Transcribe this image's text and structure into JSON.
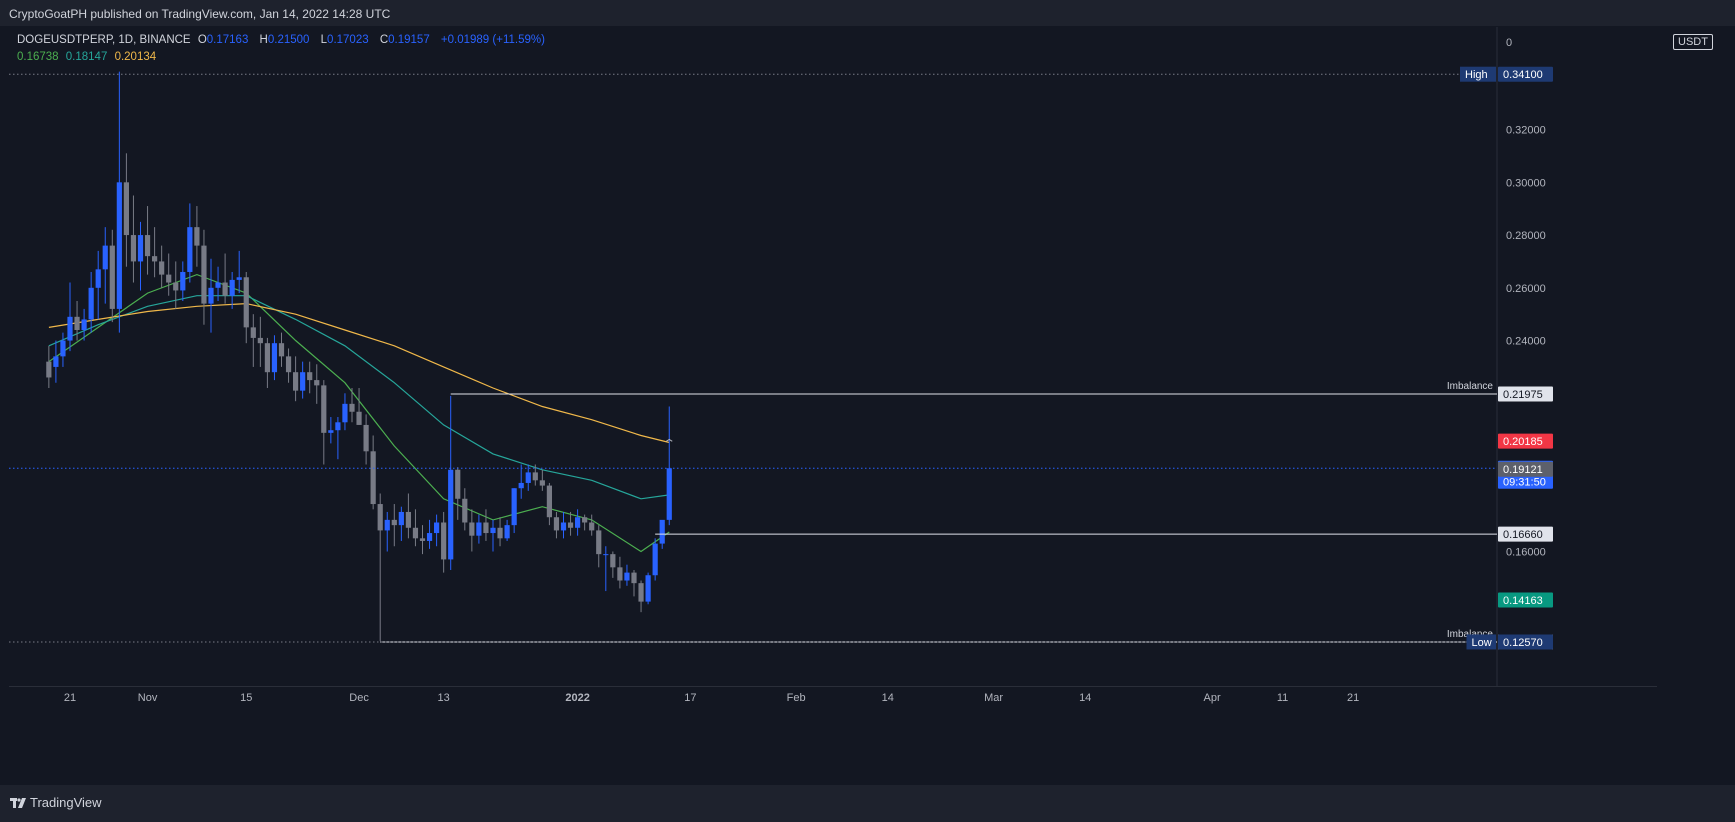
{
  "header": {
    "published": "CryptoGoatPH published on TradingView.com, Jan 14, 2022 14:28 UTC"
  },
  "legend": {
    "symbol": "DOGEUSDTPERP, 1D, BINANCE",
    "open_label": "O",
    "open": "0.17163",
    "high_label": "H",
    "high": "0.21500",
    "low_label": "L",
    "low": "0.17023",
    "close_label": "C",
    "close": "0.19157",
    "change": "+0.01989 (+11.59%)",
    "ma_values": [
      "0.16738",
      "0.18147",
      "0.20134"
    ]
  },
  "unit": "USDT",
  "footer": {
    "brand": "TradingView"
  },
  "colors": {
    "background": "#131722",
    "bull": "#2962ff",
    "bear": "#787b86",
    "ma_fast": "#4caf50",
    "ma_mid": "#26a69a",
    "ma_slow": "#f0b84a",
    "price_line": "#2962ff",
    "red_label": "#f23645",
    "teal_label": "#089981",
    "navy_label": "#1e3a73"
  },
  "chart_data": {
    "type": "candlestick",
    "x_ticks": [
      "21",
      "Nov",
      "15",
      "Dec",
      "13",
      "2022",
      "17",
      "Feb",
      "14",
      "Mar",
      "14",
      "Apr",
      "11",
      "21"
    ],
    "x_tick_dates": [
      "2021-10-21",
      "2021-11-01",
      "2021-11-15",
      "2021-12-01",
      "2021-12-13",
      "2022-01-01",
      "2022-01-17",
      "2022-02-01",
      "2022-02-14",
      "2022-03-01",
      "2022-03-14",
      "2022-04-01",
      "2022-04-11",
      "2022-04-21"
    ],
    "y_ticks": [
      "0.34100",
      "0.32000",
      "0.30000",
      "0.28000",
      "0.26000",
      "0.24000",
      "0.16000",
      "0.14163",
      "0.12570"
    ],
    "y_axis_top_label": "0",
    "ylim": [
      0.109,
      0.3589
    ],
    "candles": [
      {
        "d": "2021-10-18",
        "o": 0.232,
        "h": 0.238,
        "l": 0.222,
        "c": 0.226
      },
      {
        "d": "2021-10-19",
        "o": 0.23,
        "h": 0.24,
        "l": 0.224,
        "c": 0.234
      },
      {
        "d": "2021-10-20",
        "o": 0.234,
        "h": 0.243,
        "l": 0.23,
        "c": 0.24
      },
      {
        "d": "2021-10-21",
        "o": 0.24,
        "h": 0.262,
        "l": 0.236,
        "c": 0.249
      },
      {
        "d": "2021-10-22",
        "o": 0.249,
        "h": 0.255,
        "l": 0.24,
        "c": 0.244
      },
      {
        "d": "2021-10-23",
        "o": 0.244,
        "h": 0.252,
        "l": 0.24,
        "c": 0.248
      },
      {
        "d": "2021-10-24",
        "o": 0.248,
        "h": 0.266,
        "l": 0.243,
        "c": 0.26
      },
      {
        "d": "2021-10-25",
        "o": 0.26,
        "h": 0.274,
        "l": 0.248,
        "c": 0.267
      },
      {
        "d": "2021-10-26",
        "o": 0.267,
        "h": 0.283,
        "l": 0.254,
        "c": 0.276
      },
      {
        "d": "2021-10-27",
        "o": 0.276,
        "h": 0.282,
        "l": 0.247,
        "c": 0.252
      },
      {
        "d": "2021-10-28",
        "o": 0.252,
        "h": 0.342,
        "l": 0.243,
        "c": 0.3
      },
      {
        "d": "2021-10-29",
        "o": 0.3,
        "h": 0.311,
        "l": 0.268,
        "c": 0.28
      },
      {
        "d": "2021-10-30",
        "o": 0.28,
        "h": 0.295,
        "l": 0.262,
        "c": 0.27
      },
      {
        "d": "2021-10-31",
        "o": 0.27,
        "h": 0.285,
        "l": 0.259,
        "c": 0.28
      },
      {
        "d": "2021-11-01",
        "o": 0.28,
        "h": 0.291,
        "l": 0.265,
        "c": 0.272
      },
      {
        "d": "2021-11-02",
        "o": 0.272,
        "h": 0.283,
        "l": 0.264,
        "c": 0.27
      },
      {
        "d": "2021-11-03",
        "o": 0.27,
        "h": 0.276,
        "l": 0.26,
        "c": 0.265
      },
      {
        "d": "2021-11-04",
        "o": 0.265,
        "h": 0.273,
        "l": 0.257,
        "c": 0.262
      },
      {
        "d": "2021-11-05",
        "o": 0.262,
        "h": 0.27,
        "l": 0.252,
        "c": 0.259
      },
      {
        "d": "2021-11-06",
        "o": 0.259,
        "h": 0.27,
        "l": 0.255,
        "c": 0.266
      },
      {
        "d": "2021-11-07",
        "o": 0.266,
        "h": 0.292,
        "l": 0.262,
        "c": 0.283
      },
      {
        "d": "2021-11-08",
        "o": 0.283,
        "h": 0.291,
        "l": 0.268,
        "c": 0.276
      },
      {
        "d": "2021-11-09",
        "o": 0.276,
        "h": 0.282,
        "l": 0.246,
        "c": 0.254
      },
      {
        "d": "2021-11-10",
        "o": 0.254,
        "h": 0.271,
        "l": 0.243,
        "c": 0.26
      },
      {
        "d": "2021-11-11",
        "o": 0.26,
        "h": 0.268,
        "l": 0.255,
        "c": 0.262
      },
      {
        "d": "2021-11-12",
        "o": 0.262,
        "h": 0.273,
        "l": 0.254,
        "c": 0.257
      },
      {
        "d": "2021-11-13",
        "o": 0.257,
        "h": 0.266,
        "l": 0.252,
        "c": 0.263
      },
      {
        "d": "2021-11-14",
        "o": 0.263,
        "h": 0.274,
        "l": 0.258,
        "c": 0.264
      },
      {
        "d": "2021-11-15",
        "o": 0.264,
        "h": 0.266,
        "l": 0.239,
        "c": 0.245
      },
      {
        "d": "2021-11-16",
        "o": 0.245,
        "h": 0.25,
        "l": 0.23,
        "c": 0.241
      },
      {
        "d": "2021-11-17",
        "o": 0.241,
        "h": 0.249,
        "l": 0.23,
        "c": 0.239
      },
      {
        "d": "2021-11-18",
        "o": 0.239,
        "h": 0.241,
        "l": 0.222,
        "c": 0.228
      },
      {
        "d": "2021-11-19",
        "o": 0.228,
        "h": 0.242,
        "l": 0.225,
        "c": 0.239
      },
      {
        "d": "2021-11-20",
        "o": 0.239,
        "h": 0.243,
        "l": 0.23,
        "c": 0.234
      },
      {
        "d": "2021-11-21",
        "o": 0.234,
        "h": 0.237,
        "l": 0.224,
        "c": 0.228
      },
      {
        "d": "2021-11-22",
        "o": 0.228,
        "h": 0.234,
        "l": 0.217,
        "c": 0.221
      },
      {
        "d": "2021-11-23",
        "o": 0.221,
        "h": 0.232,
        "l": 0.218,
        "c": 0.228
      },
      {
        "d": "2021-11-24",
        "o": 0.228,
        "h": 0.232,
        "l": 0.22,
        "c": 0.225
      },
      {
        "d": "2021-11-25",
        "o": 0.225,
        "h": 0.231,
        "l": 0.216,
        "c": 0.223
      },
      {
        "d": "2021-11-26",
        "o": 0.223,
        "h": 0.225,
        "l": 0.193,
        "c": 0.205
      },
      {
        "d": "2021-11-27",
        "o": 0.205,
        "h": 0.211,
        "l": 0.201,
        "c": 0.206
      },
      {
        "d": "2021-11-28",
        "o": 0.206,
        "h": 0.211,
        "l": 0.195,
        "c": 0.209
      },
      {
        "d": "2021-11-29",
        "o": 0.209,
        "h": 0.22,
        "l": 0.206,
        "c": 0.216
      },
      {
        "d": "2021-11-30",
        "o": 0.216,
        "h": 0.222,
        "l": 0.209,
        "c": 0.213
      },
      {
        "d": "2021-12-01",
        "o": 0.213,
        "h": 0.222,
        "l": 0.208,
        "c": 0.208
      },
      {
        "d": "2021-12-02",
        "o": 0.208,
        "h": 0.212,
        "l": 0.193,
        "c": 0.198
      },
      {
        "d": "2021-12-03",
        "o": 0.198,
        "h": 0.204,
        "l": 0.176,
        "c": 0.178
      },
      {
        "d": "2021-12-04",
        "o": 0.178,
        "h": 0.182,
        "l": 0.126,
        "c": 0.168
      },
      {
        "d": "2021-12-05",
        "o": 0.168,
        "h": 0.175,
        "l": 0.16,
        "c": 0.172
      },
      {
        "d": "2021-12-06",
        "o": 0.172,
        "h": 0.178,
        "l": 0.162,
        "c": 0.17
      },
      {
        "d": "2021-12-07",
        "o": 0.17,
        "h": 0.177,
        "l": 0.164,
        "c": 0.175
      },
      {
        "d": "2021-12-08",
        "o": 0.175,
        "h": 0.182,
        "l": 0.165,
        "c": 0.169
      },
      {
        "d": "2021-12-09",
        "o": 0.169,
        "h": 0.176,
        "l": 0.162,
        "c": 0.165
      },
      {
        "d": "2021-12-10",
        "o": 0.165,
        "h": 0.17,
        "l": 0.159,
        "c": 0.164
      },
      {
        "d": "2021-12-11",
        "o": 0.164,
        "h": 0.172,
        "l": 0.161,
        "c": 0.167
      },
      {
        "d": "2021-12-12",
        "o": 0.167,
        "h": 0.174,
        "l": 0.162,
        "c": 0.171
      },
      {
        "d": "2021-12-13",
        "o": 0.171,
        "h": 0.175,
        "l": 0.152,
        "c": 0.157
      },
      {
        "d": "2021-12-14",
        "o": 0.157,
        "h": 0.219,
        "l": 0.153,
        "c": 0.191
      },
      {
        "d": "2021-12-15",
        "o": 0.191,
        "h": 0.192,
        "l": 0.172,
        "c": 0.18
      },
      {
        "d": "2021-12-16",
        "o": 0.18,
        "h": 0.184,
        "l": 0.168,
        "c": 0.171
      },
      {
        "d": "2021-12-17",
        "o": 0.171,
        "h": 0.176,
        "l": 0.16,
        "c": 0.166
      },
      {
        "d": "2021-12-18",
        "o": 0.166,
        "h": 0.174,
        "l": 0.163,
        "c": 0.171
      },
      {
        "d": "2021-12-19",
        "o": 0.171,
        "h": 0.176,
        "l": 0.164,
        "c": 0.167
      },
      {
        "d": "2021-12-20",
        "o": 0.167,
        "h": 0.172,
        "l": 0.16,
        "c": 0.169
      },
      {
        "d": "2021-12-21",
        "o": 0.169,
        "h": 0.173,
        "l": 0.162,
        "c": 0.165
      },
      {
        "d": "2021-12-22",
        "o": 0.165,
        "h": 0.172,
        "l": 0.164,
        "c": 0.17
      },
      {
        "d": "2021-12-23",
        "o": 0.17,
        "h": 0.184,
        "l": 0.167,
        "c": 0.184
      },
      {
        "d": "2021-12-24",
        "o": 0.184,
        "h": 0.193,
        "l": 0.18,
        "c": 0.186
      },
      {
        "d": "2021-12-25",
        "o": 0.186,
        "h": 0.193,
        "l": 0.183,
        "c": 0.19
      },
      {
        "d": "2021-12-26",
        "o": 0.19,
        "h": 0.193,
        "l": 0.185,
        "c": 0.187
      },
      {
        "d": "2021-12-27",
        "o": 0.187,
        "h": 0.191,
        "l": 0.183,
        "c": 0.185
      },
      {
        "d": "2021-12-28",
        "o": 0.185,
        "h": 0.186,
        "l": 0.17,
        "c": 0.173
      },
      {
        "d": "2021-12-29",
        "o": 0.173,
        "h": 0.175,
        "l": 0.165,
        "c": 0.168
      },
      {
        "d": "2021-12-30",
        "o": 0.168,
        "h": 0.175,
        "l": 0.165,
        "c": 0.171
      },
      {
        "d": "2021-12-31",
        "o": 0.171,
        "h": 0.175,
        "l": 0.166,
        "c": 0.169
      },
      {
        "d": "2022-01-01",
        "o": 0.169,
        "h": 0.176,
        "l": 0.166,
        "c": 0.173
      },
      {
        "d": "2022-01-02",
        "o": 0.173,
        "h": 0.174,
        "l": 0.168,
        "c": 0.171
      },
      {
        "d": "2022-01-03",
        "o": 0.171,
        "h": 0.174,
        "l": 0.166,
        "c": 0.168
      },
      {
        "d": "2022-01-04",
        "o": 0.168,
        "h": 0.17,
        "l": 0.154,
        "c": 0.159
      },
      {
        "d": "2022-01-05",
        "o": 0.159,
        "h": 0.162,
        "l": 0.145,
        "c": 0.159
      },
      {
        "d": "2022-01-06",
        "o": 0.159,
        "h": 0.16,
        "l": 0.15,
        "c": 0.154
      },
      {
        "d": "2022-01-07",
        "o": 0.154,
        "h": 0.158,
        "l": 0.146,
        "c": 0.149
      },
      {
        "d": "2022-01-08",
        "o": 0.149,
        "h": 0.155,
        "l": 0.147,
        "c": 0.152
      },
      {
        "d": "2022-01-09",
        "o": 0.152,
        "h": 0.153,
        "l": 0.143,
        "c": 0.148
      },
      {
        "d": "2022-01-10",
        "o": 0.148,
        "h": 0.149,
        "l": 0.137,
        "c": 0.141
      },
      {
        "d": "2022-01-11",
        "o": 0.141,
        "h": 0.152,
        "l": 0.14,
        "c": 0.151
      },
      {
        "d": "2022-01-12",
        "o": 0.151,
        "h": 0.165,
        "l": 0.149,
        "c": 0.163
      },
      {
        "d": "2022-01-13",
        "o": 0.163,
        "h": 0.171,
        "l": 0.161,
        "c": 0.172
      },
      {
        "d": "2022-01-14",
        "o": 0.172,
        "h": 0.215,
        "l": 0.17,
        "c": 0.19157
      }
    ],
    "moving_averages": [
      {
        "value": "0.16738",
        "color": "#4caf50",
        "points": [
          [
            "2021-10-18",
            0.232
          ],
          [
            "2021-10-25",
            0.245
          ],
          [
            "2021-11-01",
            0.258
          ],
          [
            "2021-11-08",
            0.265
          ],
          [
            "2021-11-15",
            0.258
          ],
          [
            "2021-11-22",
            0.24
          ],
          [
            "2021-11-29",
            0.224
          ],
          [
            "2021-12-06",
            0.2
          ],
          [
            "2021-12-13",
            0.18
          ],
          [
            "2021-12-20",
            0.172
          ],
          [
            "2021-12-27",
            0.177
          ],
          [
            "2022-01-03",
            0.172
          ],
          [
            "2022-01-10",
            0.16
          ],
          [
            "2022-01-14",
            0.16738
          ]
        ]
      },
      {
        "value": "0.18147",
        "color": "#26a69a",
        "points": [
          [
            "2021-10-18",
            0.238
          ],
          [
            "2021-10-25",
            0.246
          ],
          [
            "2021-11-01",
            0.253
          ],
          [
            "2021-11-08",
            0.257
          ],
          [
            "2021-11-15",
            0.257
          ],
          [
            "2021-11-22",
            0.248
          ],
          [
            "2021-11-29",
            0.238
          ],
          [
            "2021-12-06",
            0.224
          ],
          [
            "2021-12-13",
            0.208
          ],
          [
            "2021-12-20",
            0.197
          ],
          [
            "2021-12-27",
            0.191
          ],
          [
            "2022-01-03",
            0.187
          ],
          [
            "2022-01-10",
            0.18
          ],
          [
            "2022-01-14",
            0.18147
          ]
        ]
      },
      {
        "value": "0.20134",
        "color": "#f0b84a",
        "points": [
          [
            "2021-10-18",
            0.245
          ],
          [
            "2021-10-25",
            0.248
          ],
          [
            "2021-11-01",
            0.251
          ],
          [
            "2021-11-08",
            0.253
          ],
          [
            "2021-11-15",
            0.254
          ],
          [
            "2021-11-22",
            0.25
          ],
          [
            "2021-11-29",
            0.244
          ],
          [
            "2021-12-06",
            0.238
          ],
          [
            "2021-12-13",
            0.23
          ],
          [
            "2021-12-20",
            0.222
          ],
          [
            "2021-12-27",
            0.215
          ],
          [
            "2022-01-03",
            0.21
          ],
          [
            "2022-01-10",
            0.204
          ],
          [
            "2022-01-14",
            0.20134
          ]
        ]
      }
    ],
    "horizontal_levels": [
      {
        "price": 0.341,
        "style": "dotted",
        "from": "start",
        "label": "High",
        "value": "0.34100",
        "box": "navy"
      },
      {
        "price": 0.21975,
        "style": "solid",
        "from": "2021-12-14",
        "label": "Imbalance",
        "value": "0.21975",
        "box": "light"
      },
      {
        "price": 0.20185,
        "style": "none",
        "label": "",
        "value": "0.20185",
        "box": "red"
      },
      {
        "price": 0.19157,
        "style": "dotted-blue",
        "from": "start",
        "label": "",
        "value": "0.19157",
        "countdown": "09:31:50",
        "box": "blue"
      },
      {
        "price": 0.19121,
        "style": "none",
        "label": "",
        "value": "0.19121",
        "box": "gray"
      },
      {
        "price": 0.1666,
        "style": "solid",
        "from": "2022-01-12",
        "label": "",
        "value": "0.16660",
        "box": "light"
      },
      {
        "price": 0.14163,
        "style": "none",
        "label": "",
        "value": "0.14163",
        "box": "teal"
      },
      {
        "price": 0.1257,
        "style": "solid",
        "from": "2021-12-04",
        "label": "Imbalance",
        "value": "0.12570",
        "box": "light"
      },
      {
        "price": 0.1257,
        "style": "dotted",
        "from": "start",
        "label": "Low",
        "value": "0.12570",
        "box": "navy"
      }
    ]
  }
}
